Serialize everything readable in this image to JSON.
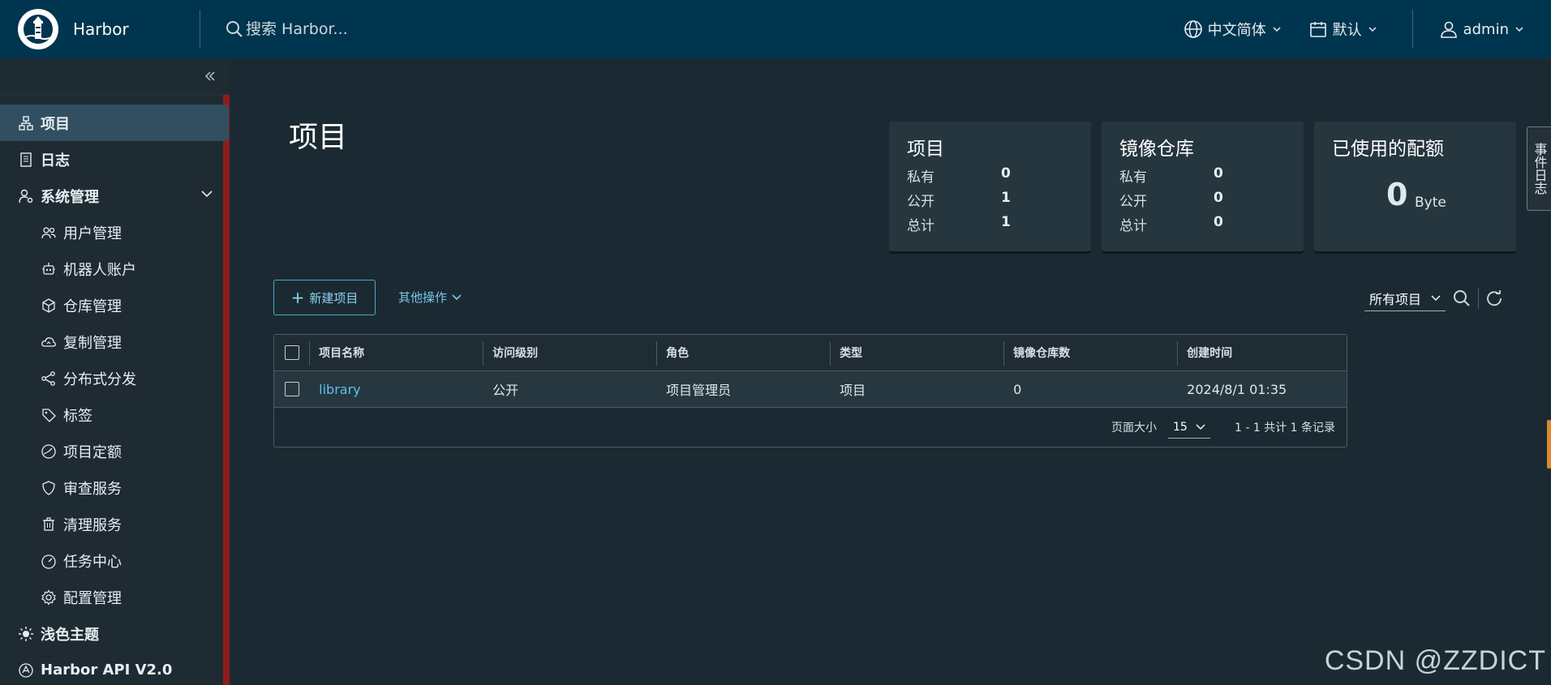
{
  "header": {
    "brand": "Harbor",
    "search_placeholder": "搜索 Harbor...",
    "language": "中文简体",
    "theme_default": "默认",
    "user": "admin"
  },
  "sidebar": {
    "items": [
      {
        "label": "项目",
        "icon": "projects-icon",
        "active": true
      },
      {
        "label": "日志",
        "icon": "log-icon"
      },
      {
        "label": "系统管理",
        "icon": "admin-icon"
      },
      {
        "label": "用户管理",
        "icon": "users-icon"
      },
      {
        "label": "机器人账户",
        "icon": "robot-icon"
      },
      {
        "label": "仓库管理",
        "icon": "registry-icon"
      },
      {
        "label": "复制管理",
        "icon": "cloud-replication-icon"
      },
      {
        "label": "分布式分发",
        "icon": "share-icon"
      },
      {
        "label": "标签",
        "icon": "tag-icon"
      },
      {
        "label": "项目定额",
        "icon": "quota-icon"
      },
      {
        "label": "审查服务",
        "icon": "shield-icon"
      },
      {
        "label": "清理服务",
        "icon": "trash-icon"
      },
      {
        "label": "任务中心",
        "icon": "dashboard-icon"
      },
      {
        "label": "配置管理",
        "icon": "gear-icon"
      },
      {
        "label": "浅色主题",
        "icon": "sun-icon"
      },
      {
        "label": "Harbor API V2.0",
        "icon": "api-icon"
      }
    ]
  },
  "main": {
    "title": "项目",
    "cards": {
      "projects": {
        "title": "项目",
        "private_label": "私有",
        "private": "0",
        "public_label": "公开",
        "public": "1",
        "total_label": "总计",
        "total": "1"
      },
      "repos": {
        "title": "镜像仓库",
        "private_label": "私有",
        "private": "0",
        "public_label": "公开",
        "public": "0",
        "total_label": "总计",
        "total": "0"
      },
      "quota": {
        "title": "已使用的配额",
        "value": "0",
        "unit": "Byte"
      }
    },
    "new_project": "新建项目",
    "other_actions": "其他操作",
    "filter": "所有项目",
    "table": {
      "columns": [
        "项目名称",
        "访问级别",
        "角色",
        "类型",
        "镜像仓库数",
        "创建时间"
      ],
      "rows": [
        {
          "name": "library",
          "access": "公开",
          "role": "项目管理员",
          "type": "项目",
          "repo_count": "0",
          "created": "2024/8/1 01:35"
        }
      ],
      "page_size_label": "页面大小",
      "page_size": "15",
      "summary": "1 - 1 共计 1 条记录"
    },
    "event_log": "事件日志"
  },
  "watermark": "CSDN @ZZDICT",
  "colors": {
    "header_bg": "#00354f",
    "sidebar_bg": "#1f2b33",
    "main_bg": "#1b2a32",
    "accent": "#49a7cf",
    "active_nav": "#324f61"
  }
}
